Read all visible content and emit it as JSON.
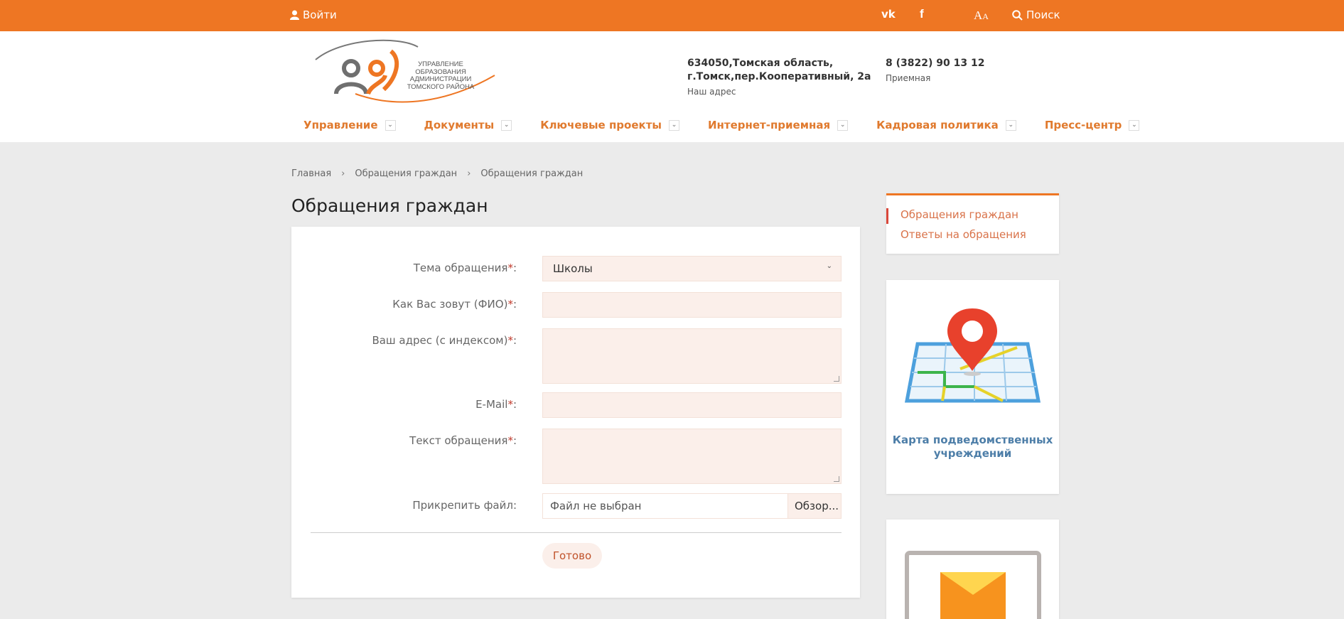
{
  "topbar": {
    "login_label": "Войти",
    "vk_label": "vk",
    "fb_label": "f",
    "font_size_label_big": "A",
    "font_size_label_small": "A",
    "search_label": "Поиск"
  },
  "header": {
    "logo_text": "Управление образования администрации томского района",
    "address": {
      "line1": "634050,Томская область,",
      "line2": "г.Томск,пер.Кооперативный, 2а",
      "caption": "Наш адрес"
    },
    "phone": {
      "number": "8 (3822) 90 13 12",
      "caption": "Приемная"
    }
  },
  "nav": {
    "items": [
      {
        "label": "Управление"
      },
      {
        "label": "Документы"
      },
      {
        "label": "Ключевые проекты"
      },
      {
        "label": "Интернет-приемная"
      },
      {
        "label": "Кадровая политика"
      },
      {
        "label": "Пресс-центр"
      }
    ]
  },
  "breadcrumb": {
    "items": [
      "Главная",
      "Обращения граждан",
      "Обращения граждан"
    ],
    "separator": "›"
  },
  "page_title": "Обращения граждан",
  "form": {
    "topic": {
      "label": "Тема обращения",
      "value": "Школы"
    },
    "name": {
      "label": "Как Вас зовут (ФИО)",
      "value": ""
    },
    "address": {
      "label": "Ваш адрес (с индексом)",
      "value": ""
    },
    "email": {
      "label": "E-Mail",
      "value": ""
    },
    "text": {
      "label": "Текст обращения",
      "value": ""
    },
    "file": {
      "label": "Прикрепить файл:",
      "status": "Файл не выбран",
      "browse_label": "Обзор..."
    },
    "required_mark": "*",
    "colon": ":",
    "submit_label": "Готово"
  },
  "sidebar": {
    "menu": [
      {
        "label": "Обращения граждан",
        "active": true
      },
      {
        "label": "Ответы на обращения",
        "active": false
      }
    ],
    "map_card": {
      "caption": "Карта подведомственных учреждений",
      "icon": "map-pin-icon"
    },
    "mail_card": {
      "icon": "envelope-icon"
    }
  },
  "colors": {
    "accent": "#ee7623",
    "field_bg": "#fbefea",
    "link": "#d9734a",
    "map_caption": "#4d7ea8"
  }
}
